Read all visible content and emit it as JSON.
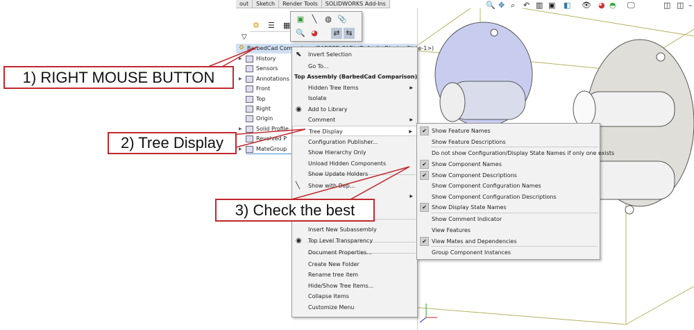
{
  "ribbon_tabs": [
    "out",
    "Sketch",
    "Render Tools",
    "SOLIDWORKS Add-Ins"
  ],
  "tree": {
    "root": "BarbedCad Comparison (BARBED CAD) (Default<Display State-1>)",
    "items": [
      {
        "label": "History",
        "expandable": true
      },
      {
        "label": "Sensors",
        "expandable": false
      },
      {
        "label": "Annotations",
        "expandable": true
      },
      {
        "label": "Front",
        "expandable": false
      },
      {
        "label": "Top",
        "expandable": false
      },
      {
        "label": "Right",
        "expandable": false
      },
      {
        "label": "Origin",
        "expandable": false
      },
      {
        "label": "Solid Profile",
        "expandable": true
      },
      {
        "label": "Revolved P",
        "expandable": false
      },
      {
        "label": "MateGroup",
        "expandable": true
      }
    ]
  },
  "context_menu": {
    "items": [
      {
        "label": "Invert Selection",
        "icon": "cursor-icon"
      },
      {
        "label": "Go To..."
      },
      {
        "label": "Top Assembly (BarbedCad Comparison)",
        "header": true
      },
      {
        "label": "Hidden Tree Items",
        "submenu": true
      },
      {
        "label": "Isolate"
      },
      {
        "label": "Add to Library",
        "icon": "library-icon"
      },
      {
        "label": "Comment",
        "submenu": true
      },
      {
        "label": "Tree Display",
        "submenu": true,
        "highlighted": true
      },
      {
        "label": "Configuration Publisher..."
      },
      {
        "label": "Show Hierarchy Only"
      },
      {
        "label": "Unload Hidden Components"
      },
      {
        "label": "Show Update Holders"
      },
      {
        "label": "Show with Dep...",
        "icon": "dependency-icon"
      },
      {
        "label": "",
        "submenu": true
      },
      {
        "label": "Insert New Subassembly"
      },
      {
        "label": "Top Level Transparency",
        "icon": "transparency-icon"
      },
      {
        "label": "Document Properties..."
      },
      {
        "label": "Create New Folder"
      },
      {
        "label": "Rename tree item"
      },
      {
        "label": "Hide/Show Tree Items..."
      },
      {
        "label": "Collapse Items"
      },
      {
        "label": "Customize Menu"
      }
    ]
  },
  "tree_display_submenu": [
    {
      "label": "Show Feature Names",
      "checked": true
    },
    {
      "label": "Show Feature Descriptions",
      "checked": false
    },
    {
      "label": "Do not show Configuration/Display State Names if only one exists",
      "checked": false
    },
    {
      "label": "Show Component Names",
      "checked": true
    },
    {
      "label": "Show Component Descriptions",
      "checked": true
    },
    {
      "label": "Show Component Configuration Names",
      "checked": false
    },
    {
      "label": "Show Component Configuration Descriptions",
      "checked": false
    },
    {
      "label": "Show Display State Names",
      "checked": true
    },
    {
      "label": "Show Comment Indicator",
      "checked": false
    },
    {
      "label": "View Features",
      "checked": false
    },
    {
      "label": "View Mates and Dependencies",
      "checked": true
    },
    {
      "label": "Group Component Instances",
      "checked": false
    }
  ],
  "check_mark": "✔",
  "callouts": {
    "step1": "1) RIGHT MOUSE BUTTON",
    "step2": "2) Tree Display",
    "step3": "3) Check the best"
  },
  "colors": {
    "callout_border": "#c0272d",
    "selection": "#cfe0f3",
    "part_blue": "#c8cdf0",
    "part_grey": "#e0ded8",
    "bbox": "#b8b060"
  }
}
